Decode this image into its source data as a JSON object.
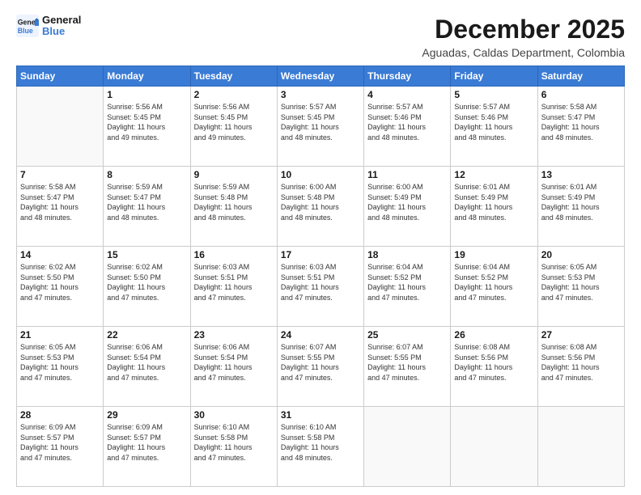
{
  "logo": {
    "line1": "General",
    "line2": "Blue"
  },
  "title": "December 2025",
  "subtitle": "Aguadas, Caldas Department, Colombia",
  "days_header": [
    "Sunday",
    "Monday",
    "Tuesday",
    "Wednesday",
    "Thursday",
    "Friday",
    "Saturday"
  ],
  "weeks": [
    [
      {
        "num": "",
        "info": ""
      },
      {
        "num": "1",
        "info": "Sunrise: 5:56 AM\nSunset: 5:45 PM\nDaylight: 11 hours\nand 49 minutes."
      },
      {
        "num": "2",
        "info": "Sunrise: 5:56 AM\nSunset: 5:45 PM\nDaylight: 11 hours\nand 49 minutes."
      },
      {
        "num": "3",
        "info": "Sunrise: 5:57 AM\nSunset: 5:45 PM\nDaylight: 11 hours\nand 48 minutes."
      },
      {
        "num": "4",
        "info": "Sunrise: 5:57 AM\nSunset: 5:46 PM\nDaylight: 11 hours\nand 48 minutes."
      },
      {
        "num": "5",
        "info": "Sunrise: 5:57 AM\nSunset: 5:46 PM\nDaylight: 11 hours\nand 48 minutes."
      },
      {
        "num": "6",
        "info": "Sunrise: 5:58 AM\nSunset: 5:47 PM\nDaylight: 11 hours\nand 48 minutes."
      }
    ],
    [
      {
        "num": "7",
        "info": "Sunrise: 5:58 AM\nSunset: 5:47 PM\nDaylight: 11 hours\nand 48 minutes."
      },
      {
        "num": "8",
        "info": "Sunrise: 5:59 AM\nSunset: 5:47 PM\nDaylight: 11 hours\nand 48 minutes."
      },
      {
        "num": "9",
        "info": "Sunrise: 5:59 AM\nSunset: 5:48 PM\nDaylight: 11 hours\nand 48 minutes."
      },
      {
        "num": "10",
        "info": "Sunrise: 6:00 AM\nSunset: 5:48 PM\nDaylight: 11 hours\nand 48 minutes."
      },
      {
        "num": "11",
        "info": "Sunrise: 6:00 AM\nSunset: 5:49 PM\nDaylight: 11 hours\nand 48 minutes."
      },
      {
        "num": "12",
        "info": "Sunrise: 6:01 AM\nSunset: 5:49 PM\nDaylight: 11 hours\nand 48 minutes."
      },
      {
        "num": "13",
        "info": "Sunrise: 6:01 AM\nSunset: 5:49 PM\nDaylight: 11 hours\nand 48 minutes."
      }
    ],
    [
      {
        "num": "14",
        "info": "Sunrise: 6:02 AM\nSunset: 5:50 PM\nDaylight: 11 hours\nand 47 minutes."
      },
      {
        "num": "15",
        "info": "Sunrise: 6:02 AM\nSunset: 5:50 PM\nDaylight: 11 hours\nand 47 minutes."
      },
      {
        "num": "16",
        "info": "Sunrise: 6:03 AM\nSunset: 5:51 PM\nDaylight: 11 hours\nand 47 minutes."
      },
      {
        "num": "17",
        "info": "Sunrise: 6:03 AM\nSunset: 5:51 PM\nDaylight: 11 hours\nand 47 minutes."
      },
      {
        "num": "18",
        "info": "Sunrise: 6:04 AM\nSunset: 5:52 PM\nDaylight: 11 hours\nand 47 minutes."
      },
      {
        "num": "19",
        "info": "Sunrise: 6:04 AM\nSunset: 5:52 PM\nDaylight: 11 hours\nand 47 minutes."
      },
      {
        "num": "20",
        "info": "Sunrise: 6:05 AM\nSunset: 5:53 PM\nDaylight: 11 hours\nand 47 minutes."
      }
    ],
    [
      {
        "num": "21",
        "info": "Sunrise: 6:05 AM\nSunset: 5:53 PM\nDaylight: 11 hours\nand 47 minutes."
      },
      {
        "num": "22",
        "info": "Sunrise: 6:06 AM\nSunset: 5:54 PM\nDaylight: 11 hours\nand 47 minutes."
      },
      {
        "num": "23",
        "info": "Sunrise: 6:06 AM\nSunset: 5:54 PM\nDaylight: 11 hours\nand 47 minutes."
      },
      {
        "num": "24",
        "info": "Sunrise: 6:07 AM\nSunset: 5:55 PM\nDaylight: 11 hours\nand 47 minutes."
      },
      {
        "num": "25",
        "info": "Sunrise: 6:07 AM\nSunset: 5:55 PM\nDaylight: 11 hours\nand 47 minutes."
      },
      {
        "num": "26",
        "info": "Sunrise: 6:08 AM\nSunset: 5:56 PM\nDaylight: 11 hours\nand 47 minutes."
      },
      {
        "num": "27",
        "info": "Sunrise: 6:08 AM\nSunset: 5:56 PM\nDaylight: 11 hours\nand 47 minutes."
      }
    ],
    [
      {
        "num": "28",
        "info": "Sunrise: 6:09 AM\nSunset: 5:57 PM\nDaylight: 11 hours\nand 47 minutes."
      },
      {
        "num": "29",
        "info": "Sunrise: 6:09 AM\nSunset: 5:57 PM\nDaylight: 11 hours\nand 47 minutes."
      },
      {
        "num": "30",
        "info": "Sunrise: 6:10 AM\nSunset: 5:58 PM\nDaylight: 11 hours\nand 47 minutes."
      },
      {
        "num": "31",
        "info": "Sunrise: 6:10 AM\nSunset: 5:58 PM\nDaylight: 11 hours\nand 48 minutes."
      },
      {
        "num": "",
        "info": ""
      },
      {
        "num": "",
        "info": ""
      },
      {
        "num": "",
        "info": ""
      }
    ]
  ]
}
